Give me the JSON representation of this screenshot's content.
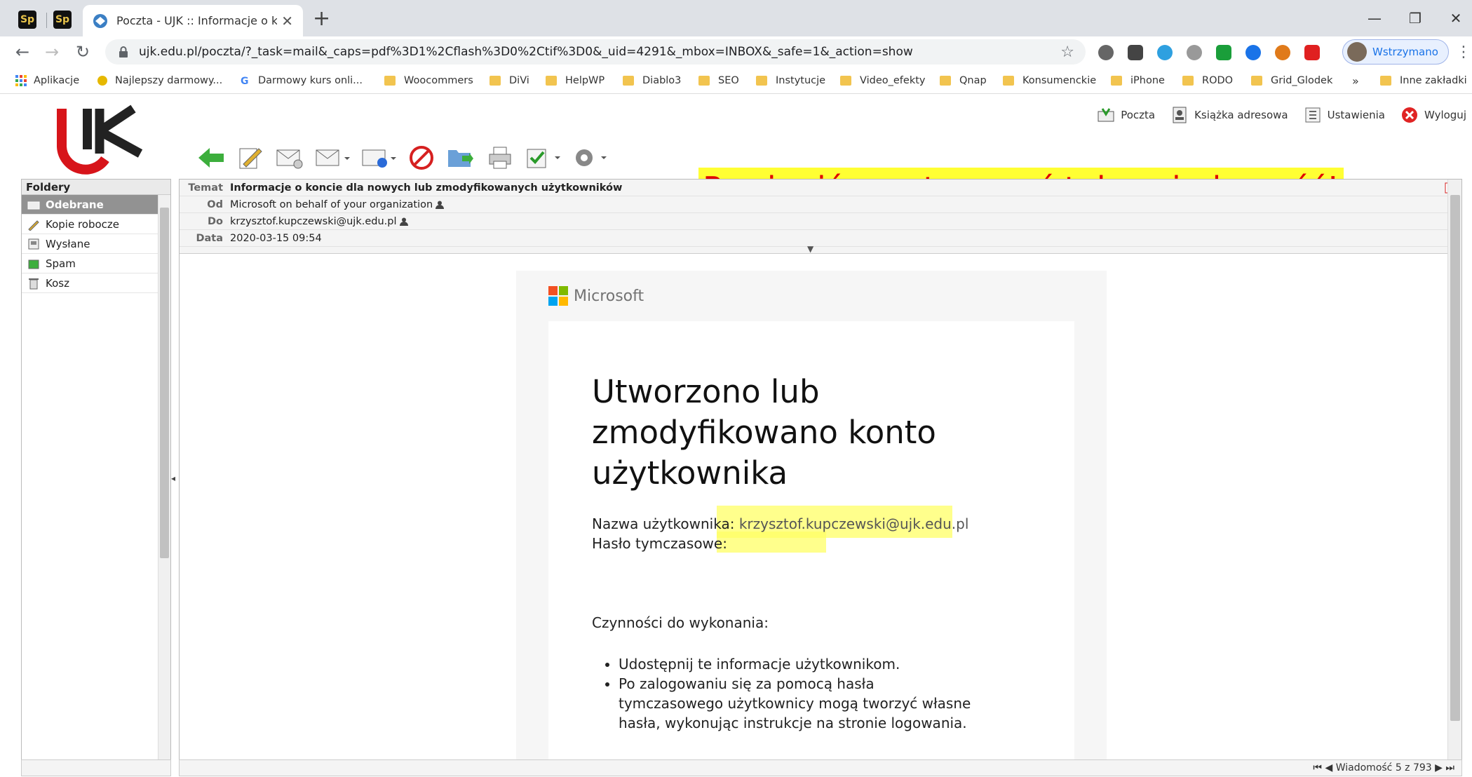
{
  "browser": {
    "pinned_tabs": [
      "Sp",
      "Sp"
    ],
    "active_tab_title": "Poczta - UJK :: Informacje o konc",
    "url": "ujk.edu.pl/poczta/?_task=mail&_caps=pdf%3D1%2Cflash%3D0%2Ctif%3D0&_uid=4291&_mbox=INBOX&_safe=1&_action=show",
    "profile_label": "Wstrzymano",
    "bookmarks": [
      "Aplikacje",
      "Najlepszy darmowy...",
      "Darmowy kurs onli...",
      "Woocommers",
      "DiVi",
      "HelpWP",
      "Diablo3",
      "SEO",
      "Instytucje",
      "Video_efekty",
      "Qnap",
      "Konsumenckie",
      "iPhone",
      "RODO",
      "Grid_Glodek",
      "»",
      "Inne zakładki"
    ]
  },
  "webmail": {
    "logo_text": "UK",
    "top_nav": {
      "mail": "Poczta",
      "addressbook": "Książka adresowa",
      "settings": "Ustawienia",
      "logout": "Wyloguj"
    },
    "callout": "Powinniśmy otrzymać taką wiadomość!",
    "folders_title": "Foldery",
    "folders": [
      "Odebrane",
      "Kopie robocze",
      "Wysłane",
      "Spam",
      "Kosz"
    ],
    "headers": {
      "subject_label": "Temat",
      "subject": "Informacje o koncie dla nowych lub zmodyfikowanych użytkowników",
      "from_label": "Od",
      "from": "Microsoft on behalf of your organization",
      "to_label": "Do",
      "to": "krzysztof.kupczewski@ujk.edu.pl",
      "date_label": "Data",
      "date": "2020-03-15 09:54"
    },
    "email": {
      "brand": "Microsoft",
      "heading": "Utworzono lub zmodyfikowano konto użytkownika",
      "username_label": "Nazwa użytkownika:",
      "username": "krzysztof.kupczewski@ujk.edu.pl",
      "password_label": "Hasło tymczasowe:",
      "actions_title": "Czynności do wykonania:",
      "actions": [
        "Udostępnij te informacje użytkownikom.",
        "Po zalogowaniu się za pomocą hasła tymczasowego użytkownicy mogą tworzyć własne hasła, wykonując instrukcje na stronie logowania."
      ]
    },
    "message_counter": "Wiadomość 5 z 793"
  },
  "colors": {
    "accent": "#1a73e8",
    "callout_bg": "#ffff33",
    "callout_text": "#e00000",
    "logo_red": "#d7141a",
    "folder_selected": "#929292"
  }
}
